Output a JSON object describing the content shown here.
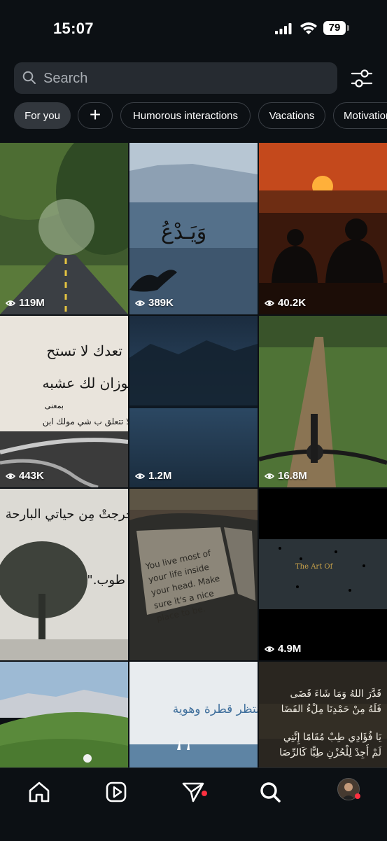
{
  "status_bar": {
    "time": "15:07",
    "battery": "79"
  },
  "search": {
    "placeholder": "Search"
  },
  "chips": [
    {
      "label": "For you"
    },
    {
      "label": "+"
    },
    {
      "label": "Humorous interactions"
    },
    {
      "label": "Vacations"
    },
    {
      "label": "Motivation"
    }
  ],
  "tiles": [
    {
      "views": "119M"
    },
    {
      "views": "389K",
      "overlay_text": "وَيَـدْعُ"
    },
    {
      "views": "40.2K"
    },
    {
      "views": "443K",
      "line1": "تعدك لا تستح",
      "line2": "لوزان لك عشبه",
      "line3": "بمعنى",
      "line4": "لا تتعلق ب شي مولك ابن"
    },
    {
      "views": "1.2M"
    },
    {
      "views": "16.8M"
    },
    {
      "line1": "خرجتْ مِن حياتي البارحة",
      "line2": "طوب.\"",
      "views_hidden": ""
    },
    {
      "note": "You live most of your life inside your head. Make sure it's a nice place to be."
    },
    {
      "views": "4.9M",
      "overlay_text": "The Art Of"
    },
    {},
    {
      "overlay_text": "تنتظر قطرة وهوية"
    },
    {
      "line1": "قَدَّرَ اللهُ وَمَا شَاءَ قَضَى",
      "line2": "فَلَهُ مِنْ حَمْدِنَا مِلْءُ الفَضَا",
      "line3": "يَا فُؤَادِي طِبْ مُقَامًا إِنَّنِي",
      "line4": "لَمْ أَجِدْ لِلْحُزْنِ طِبًّا كَالرِّضَا"
    }
  ],
  "colors": {
    "background": "#0c1014",
    "search_bg": "#262b31",
    "notification": "#ff3040"
  },
  "nav": {
    "icons": [
      "home-icon",
      "reels-icon",
      "direct-message-icon",
      "search-icon",
      "profile-avatar"
    ]
  }
}
